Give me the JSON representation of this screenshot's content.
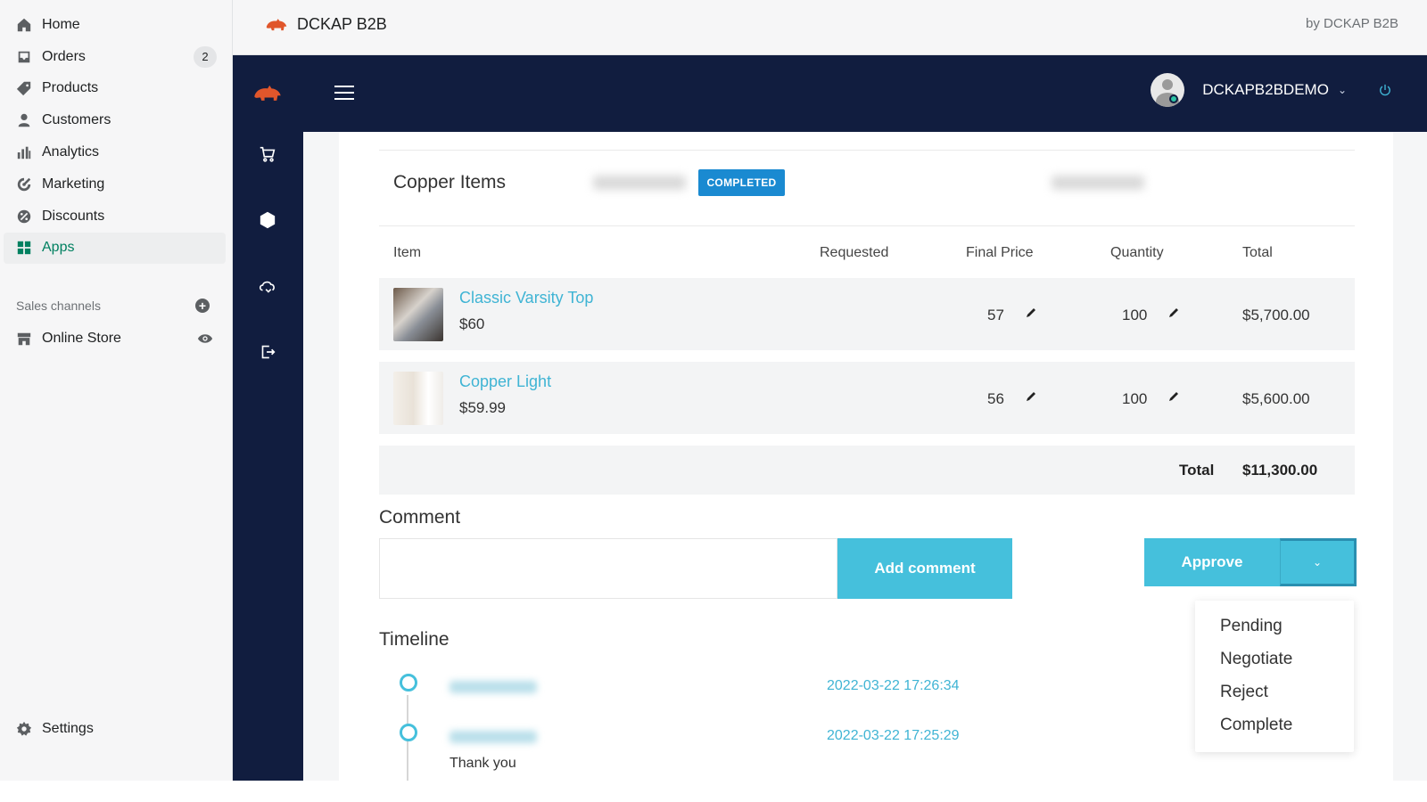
{
  "shop_sidebar": {
    "items": [
      {
        "label": "Home",
        "icon": "home-icon"
      },
      {
        "label": "Orders",
        "icon": "orders-icon",
        "badge": "2"
      },
      {
        "label": "Products",
        "icon": "tag-icon"
      },
      {
        "label": "Customers",
        "icon": "person-icon"
      },
      {
        "label": "Analytics",
        "icon": "bar-chart-icon"
      },
      {
        "label": "Marketing",
        "icon": "target-icon"
      },
      {
        "label": "Discounts",
        "icon": "discount-icon"
      },
      {
        "label": "Apps",
        "icon": "apps-icon",
        "active": true
      }
    ],
    "sales_channels_label": "Sales channels",
    "online_store_label": "Online Store",
    "settings_label": "Settings",
    "accent_color": "#008060"
  },
  "topbar": {
    "app_title": "DCKAP B2B",
    "by_text": "by DCKAP B2B"
  },
  "app_header": {
    "username": "DCKAPB2BDEMO",
    "bg_color": "#111d3f"
  },
  "quote": {
    "title": "Copper Items",
    "status": "COMPLETED",
    "status_color": "#1a8ad1",
    "columns": [
      "Item",
      "Requested",
      "Final Price",
      "Quantity",
      "Total"
    ],
    "rows": [
      {
        "name": "Classic Varsity Top",
        "price": "$60",
        "final_price": "57",
        "quantity": "100",
        "total": "$5,700.00"
      },
      {
        "name": "Copper Light",
        "price": "$59.99",
        "final_price": "56",
        "quantity": "100",
        "total": "$5,600.00"
      }
    ],
    "total_label": "Total",
    "total_value": "$11,300.00"
  },
  "comment": {
    "title": "Comment",
    "input_value": "",
    "add_button": "Add comment"
  },
  "actions": {
    "approve_label": "Approve",
    "dropdown_options": [
      "Pending",
      "Negotiate",
      "Reject",
      "Complete"
    ],
    "button_color": "#45c0dc"
  },
  "timeline": {
    "title": "Timeline",
    "entries": [
      {
        "date": "2022-03-22 17:26:34",
        "note": ""
      },
      {
        "date": "2022-03-22 17:25:29",
        "note": "Thank you"
      }
    ]
  }
}
